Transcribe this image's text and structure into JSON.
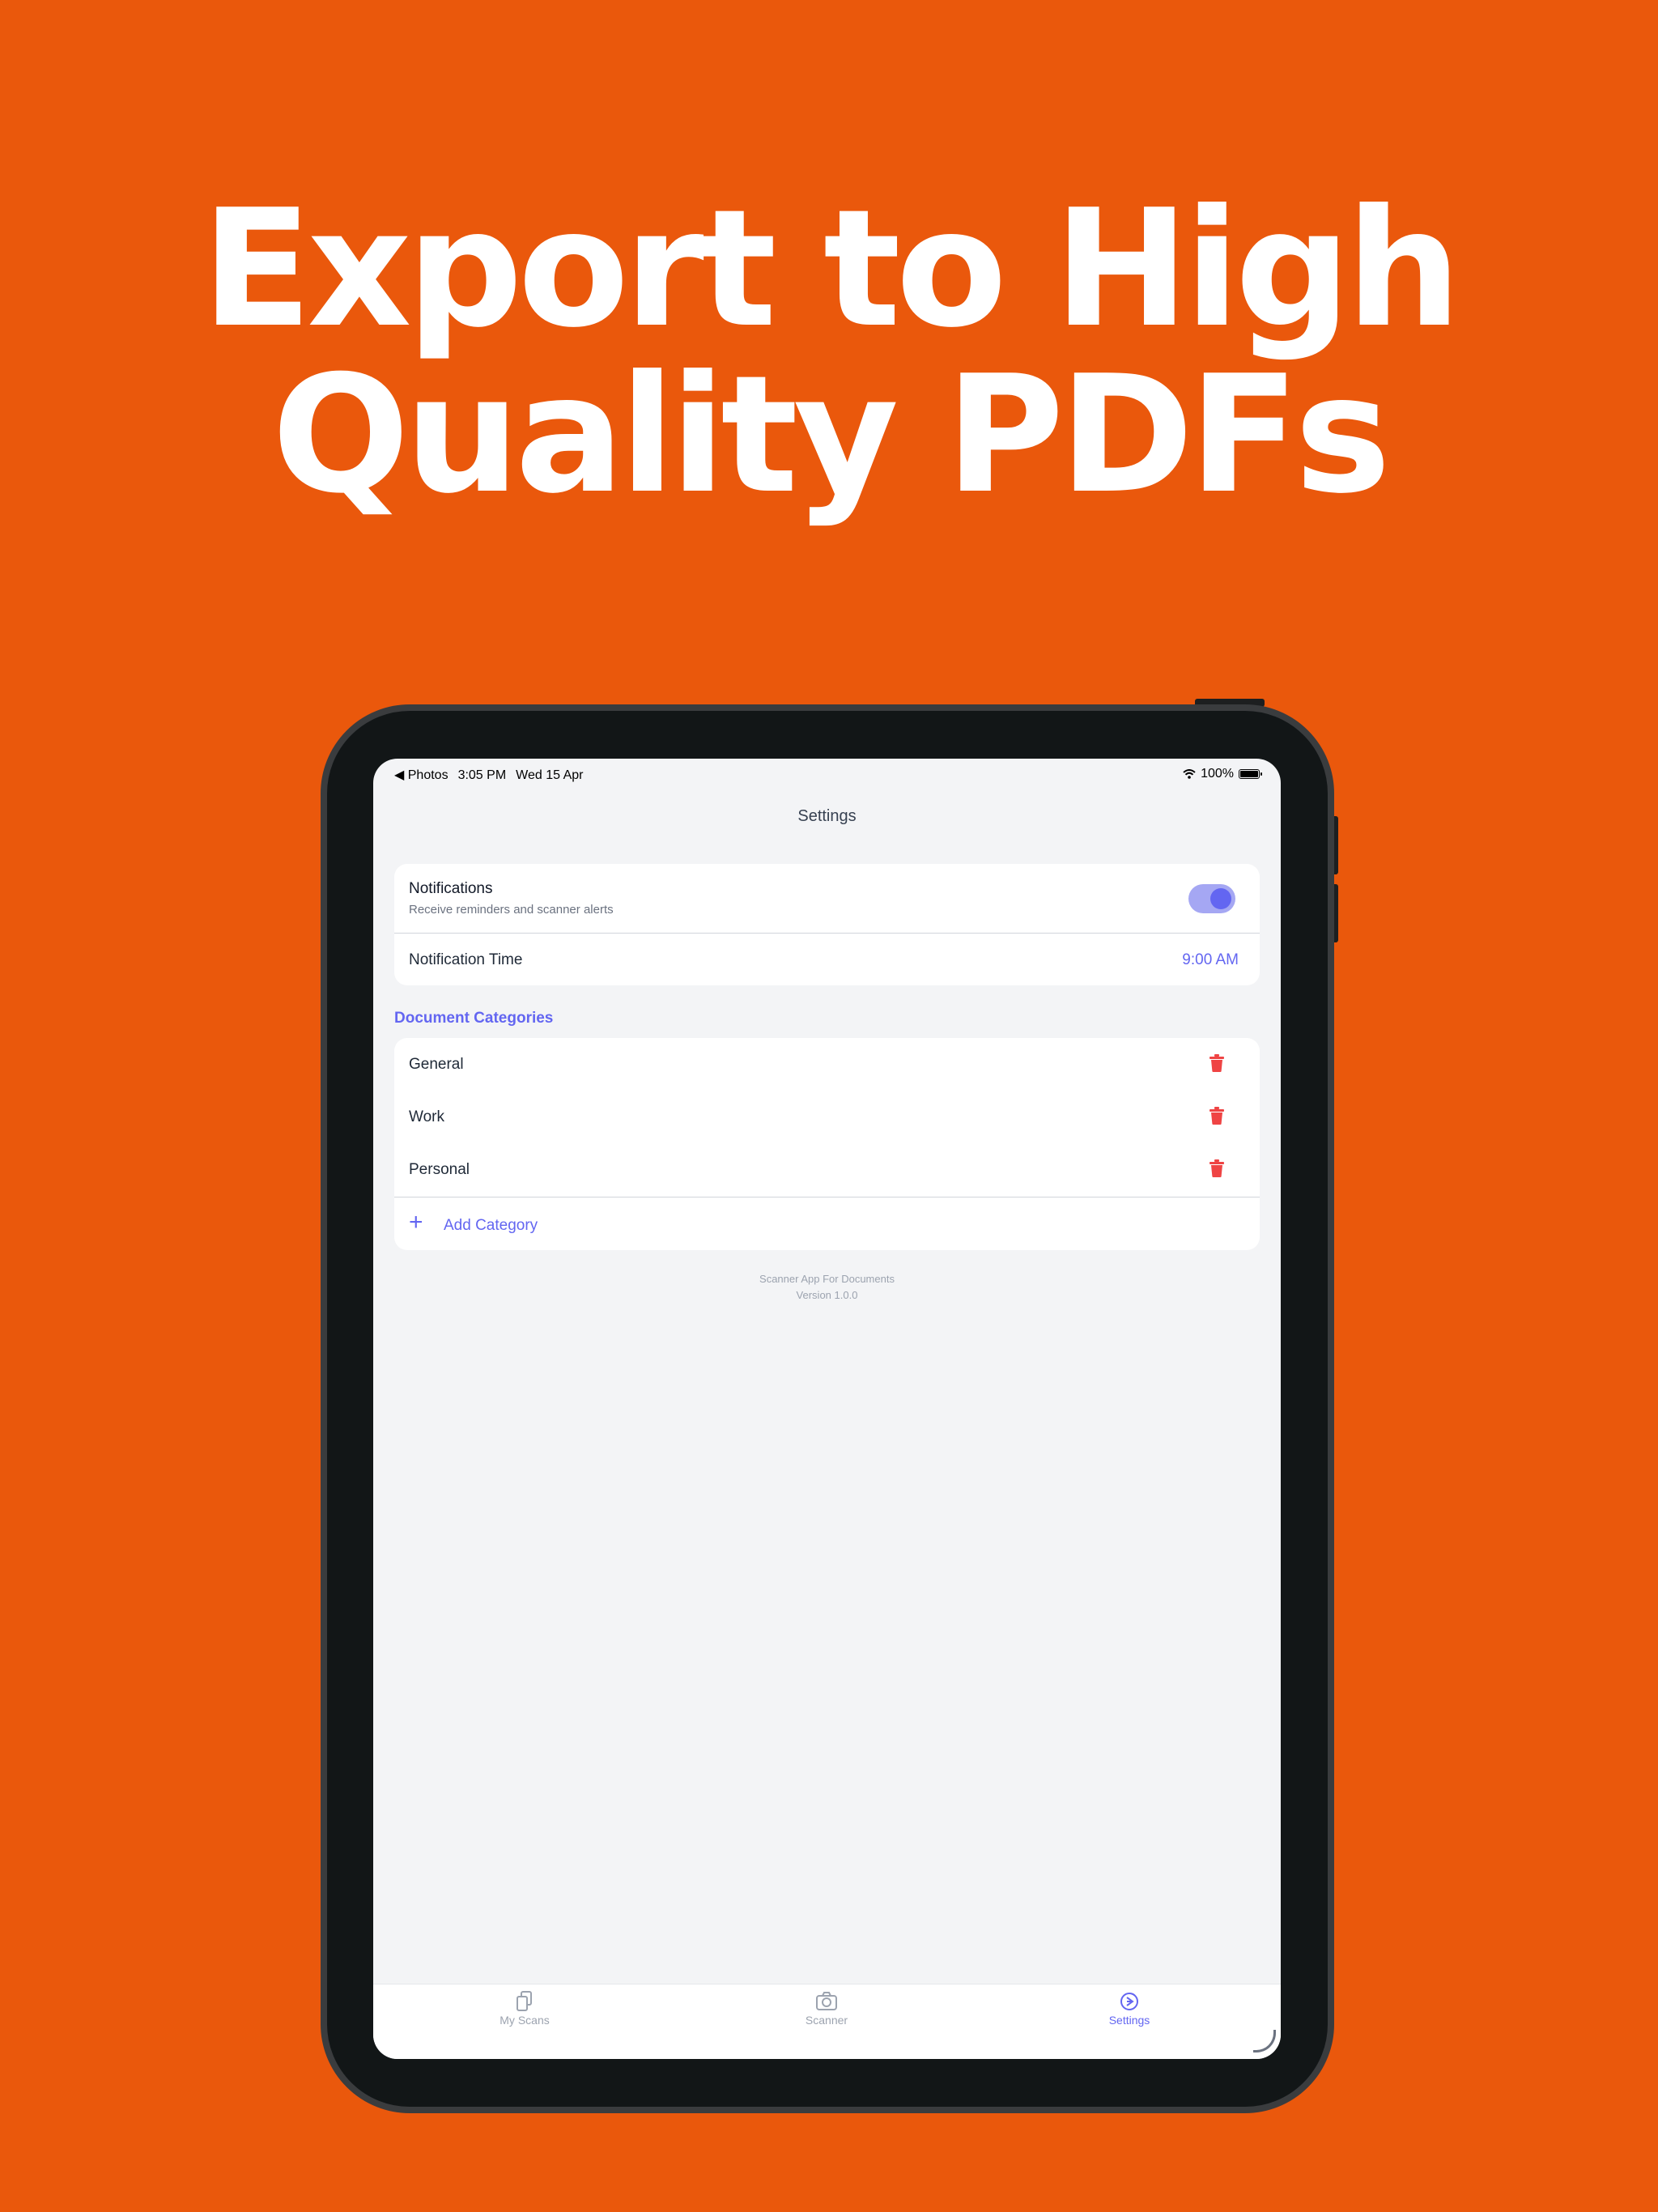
{
  "headline": {
    "line1": "Export to High",
    "line2": "Quality PDFs"
  },
  "status_bar": {
    "back_label": "◀ Photos",
    "time": "3:05 PM",
    "date": "Wed 15 Apr",
    "battery": "100%"
  },
  "nav": {
    "title": "Settings"
  },
  "notifications": {
    "title": "Notifications",
    "subtitle": "Receive reminders and scanner alerts",
    "enabled": true,
    "time_label": "Notification Time",
    "time_value": "9:00 AM"
  },
  "categories": {
    "section_title": "Document Categories",
    "items": [
      {
        "label": "General"
      },
      {
        "label": "Work"
      },
      {
        "label": "Personal"
      }
    ],
    "add_label": "Add Category"
  },
  "footer": {
    "app_name": "Scanner App For Documents",
    "version": "Version 1.0.0"
  },
  "tabs": [
    {
      "label": "My Scans",
      "icon": "documents-icon"
    },
    {
      "label": "Scanner",
      "icon": "camera-icon"
    },
    {
      "label": "Settings",
      "icon": "settings-icon",
      "active": true
    }
  ],
  "colors": {
    "background": "#EA580C",
    "accent": "#6366F1",
    "danger": "#EF4444"
  }
}
